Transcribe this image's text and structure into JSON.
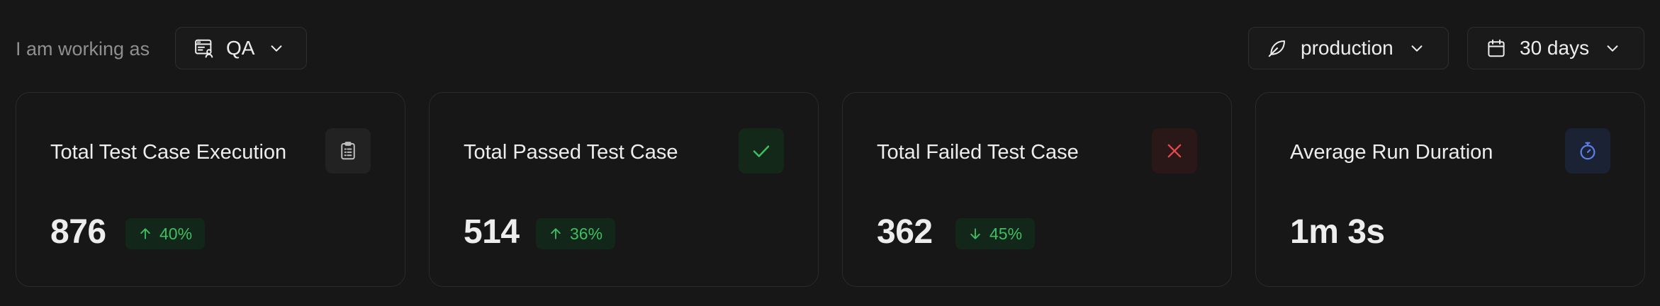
{
  "header": {
    "working_as_label": "I am working as",
    "role": {
      "label": "QA",
      "icon": "browser-user-icon"
    },
    "environment": {
      "label": "production",
      "icon": "leaf-icon"
    },
    "date_range": {
      "label": "30 days",
      "icon": "calendar-icon"
    }
  },
  "colors": {
    "background": "#171717",
    "card_border": "#2a2a2a",
    "positive": "#3fbf5f",
    "negative": "#e5484d",
    "accent_blue": "#5b7fe8"
  },
  "cards": [
    {
      "title": "Total Test Case Execution",
      "value": "876",
      "delta": "40%",
      "delta_direction": "up",
      "icon": "clipboard-list-icon"
    },
    {
      "title": "Total Passed Test Case",
      "value": "514",
      "delta": "36%",
      "delta_direction": "up",
      "icon": "check-icon"
    },
    {
      "title": "Total Failed Test Case",
      "value": "362",
      "delta": "45%",
      "delta_direction": "down",
      "icon": "x-icon"
    },
    {
      "title": "Average Run Duration",
      "value": "1m 3s",
      "icon": "stopwatch-icon"
    }
  ]
}
